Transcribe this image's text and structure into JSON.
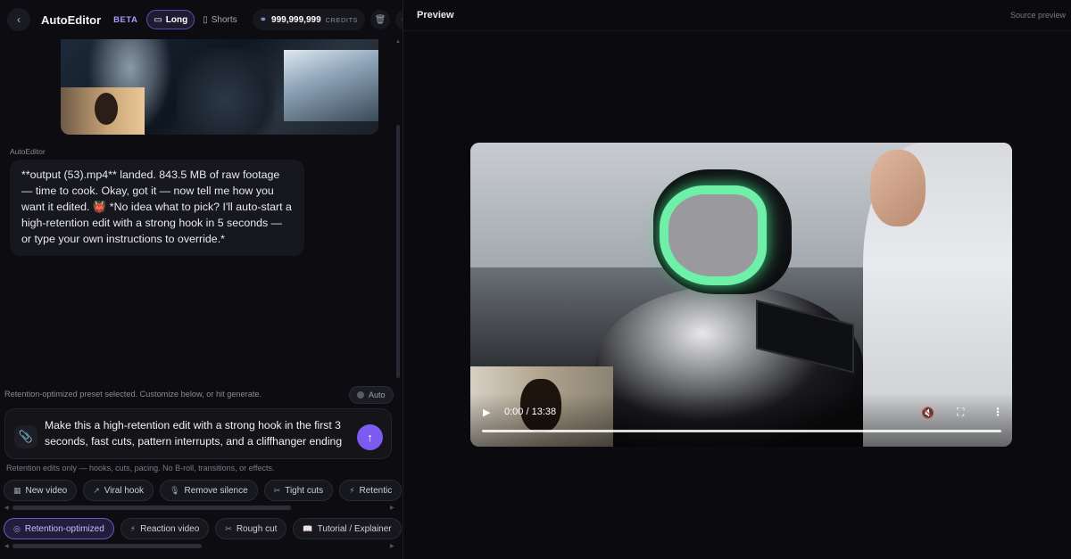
{
  "topbar": {
    "app_title": "AutoEditor",
    "beta": "BETA",
    "mode_long": "Long",
    "mode_shorts": "Shorts",
    "credits_value": "999,999,999",
    "credits_label": "CREDITS"
  },
  "chat": {
    "sender": "AutoEditor",
    "message": "**output (53).mp4** landed. 843.5 MB of raw footage — time to cook. Okay, got it — now tell me how you want it edited. 👹 *No idea what to pick? I'll auto-start a high-retention edit with a strong hook in 5 seconds — or type your own instructions to override.*"
  },
  "preset": {
    "status": "Retention-optimized preset selected. Customize below, or hit generate.",
    "auto_label": "Auto"
  },
  "composer": {
    "value": "Make this a high-retention edit with a strong hook in the first 3 seconds, fast cuts, pattern interrupts, and a cliffhanger ending",
    "hint": "Retention edits only — hooks, cuts, pacing. No B-roll, transitions, or effects."
  },
  "quick_actions": [
    {
      "label": "New video",
      "icon": "film-icon"
    },
    {
      "label": "Viral hook",
      "icon": "trending-icon"
    },
    {
      "label": "Remove silence",
      "icon": "mic-icon"
    },
    {
      "label": "Tight cuts",
      "icon": "scissors-icon"
    },
    {
      "label": "Retentic",
      "icon": "bolt-icon"
    }
  ],
  "presets": [
    {
      "label": "Retention-optimized",
      "icon": "target-icon",
      "selected": true
    },
    {
      "label": "Reaction video",
      "icon": "bolt-icon",
      "selected": false
    },
    {
      "label": "Rough cut",
      "icon": "scissors-icon",
      "selected": false
    },
    {
      "label": "Tutorial / Explainer",
      "icon": "book-icon",
      "selected": false
    }
  ],
  "preview": {
    "title": "Preview",
    "source_label": "Source preview",
    "time": "0:00 / 13:38",
    "progress": 0.0
  },
  "colors": {
    "accent": "#7c5cf0",
    "selected_chip_text": "#c8bcff",
    "visor_green": "#6ef0a8"
  }
}
